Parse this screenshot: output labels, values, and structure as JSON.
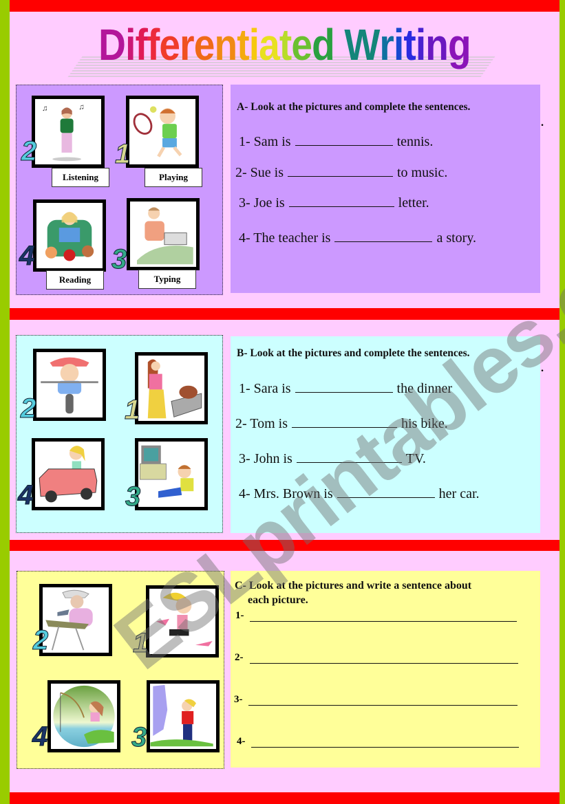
{
  "title": {
    "text": "Differentiated Writing",
    "letters": [
      "D",
      "i",
      "f",
      "f",
      "e",
      "r",
      "e",
      "n",
      "t",
      "i",
      "a",
      "t",
      "e",
      "d",
      " ",
      "W",
      "r",
      "i",
      "t",
      "i",
      "n",
      "g"
    ],
    "colors": [
      "#b3169a",
      "#cc1875",
      "#e01a55",
      "#ec2a3c",
      "#f03c2a",
      "#f05020",
      "#f06a18",
      "#f08a14",
      "#f4aa10",
      "#f6c810",
      "#e8e020",
      "#b8dc2a",
      "#6cc030",
      "#2aa040",
      "#ffffff",
      "#14857a",
      "#1070a0",
      "#1848d0",
      "#2a2ae0",
      "#4a20d0",
      "#6a18c0",
      "#8a14b8"
    ]
  },
  "sections": {
    "a": {
      "bg": "#cc99ff",
      "heading": "A- Look at the pictures and complete the sentences.",
      "pictures": [
        {
          "number": "2",
          "caption": "Listening",
          "subject": "girl listening to music"
        },
        {
          "number": "1",
          "caption": "Playing",
          "subject": "boy playing tennis"
        },
        {
          "number": "4",
          "caption": "Reading",
          "subject": "teacher reading a story"
        },
        {
          "number": "3",
          "caption": "Typing",
          "subject": "man typing a letter"
        }
      ],
      "sentences": [
        {
          "before": "1- Sam is",
          "after": "tennis."
        },
        {
          "before": "2- Sue is",
          "after": "to music."
        },
        {
          "before": "3- Joe is",
          "after": "letter."
        },
        {
          "before": "4- The teacher is",
          "after": "a story."
        }
      ]
    },
    "b": {
      "bg": "#ccffff",
      "heading": "B- Look at the pictures and complete the sentences.",
      "pictures": [
        {
          "number": "2",
          "subject": "boy riding a bike"
        },
        {
          "number": "1",
          "subject": "woman cooking"
        },
        {
          "number": "4",
          "subject": "woman driving a car"
        },
        {
          "number": "3",
          "subject": "boy watching TV"
        }
      ],
      "sentences": [
        {
          "before": "1- Sara is",
          "after": "the dinner"
        },
        {
          "before": "2- Tom is",
          "after": "his bike."
        },
        {
          "before": "3- John is",
          "after": "TV."
        },
        {
          "before": "4- Mrs. Brown is",
          "after": "her car."
        }
      ]
    },
    "c": {
      "bg": "#ffff99",
      "heading_line1": "C- Look at the pictures and write a sentence about",
      "heading_line2": "each picture.",
      "pictures": [
        {
          "number": "2",
          "subject": "woman ironing"
        },
        {
          "number": "1",
          "subject": "girl running"
        },
        {
          "number": "4",
          "subject": "girl fishing"
        },
        {
          "number": "3",
          "subject": "girl painting a wall"
        }
      ],
      "lines": [
        "1-",
        "2-",
        "3-",
        "4-"
      ]
    }
  },
  "watermark": "ESLprintables.com",
  "colors": {
    "border_green": "#99cc00",
    "page_pink": "#ffccff",
    "bar_red": "#ff0000"
  }
}
